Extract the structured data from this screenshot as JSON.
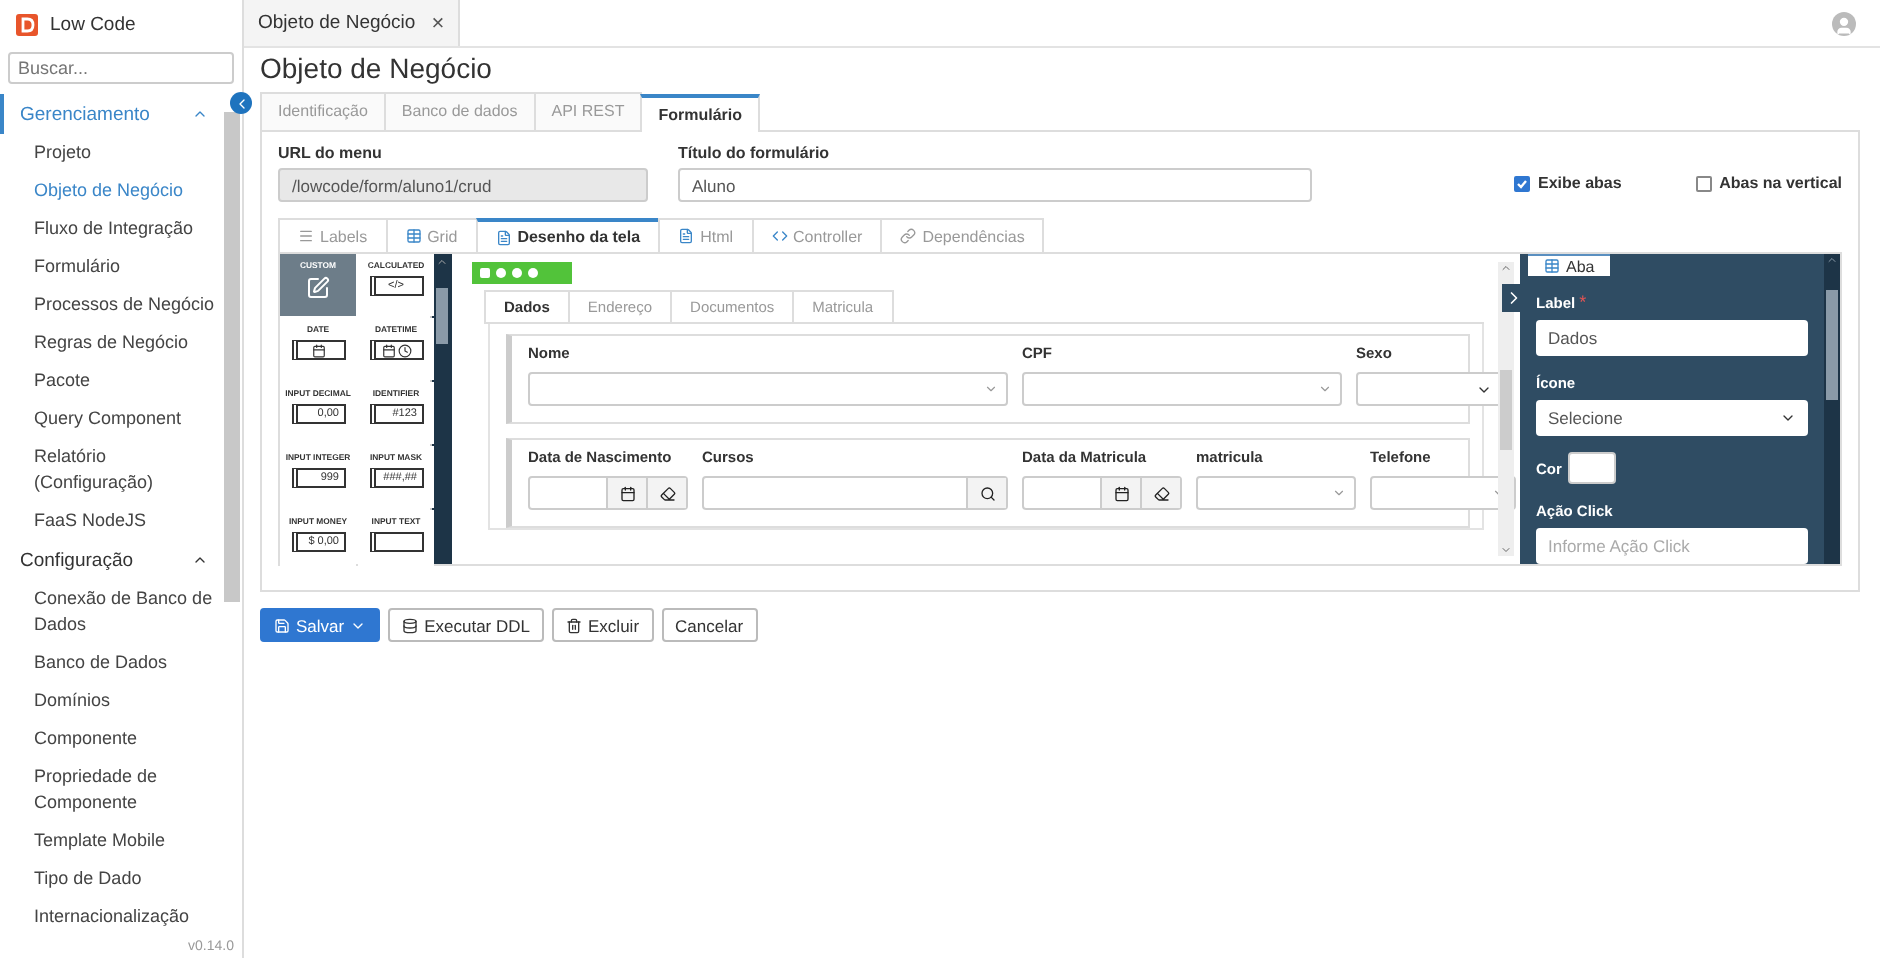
{
  "app": {
    "name": "Low Code",
    "version": "v0.14.0"
  },
  "sidebar": {
    "search": {
      "placeholder": "Buscar..."
    },
    "groups": [
      {
        "label": "Gerenciamento",
        "selected": true,
        "expanded": true,
        "items": [
          {
            "label": "Projeto",
            "selected": false
          },
          {
            "label": "Objeto de Negócio",
            "selected": true
          },
          {
            "label": "Fluxo de Integração",
            "selected": false
          },
          {
            "label": "Formulário",
            "selected": false
          },
          {
            "label": "Processos de Negócio",
            "selected": false
          },
          {
            "label": "Regras de Negócio",
            "selected": false
          },
          {
            "label": "Pacote",
            "selected": false
          },
          {
            "label": "Query Component",
            "selected": false
          },
          {
            "label": "Relatório (Configuração)",
            "selected": false
          },
          {
            "label": "FaaS NodeJS",
            "selected": false
          }
        ]
      },
      {
        "label": "Configuração",
        "selected": false,
        "expanded": true,
        "items": [
          {
            "label": "Conexão de Banco de Dados",
            "selected": false
          },
          {
            "label": "Banco de Dados",
            "selected": false
          },
          {
            "label": "Domínios",
            "selected": false
          },
          {
            "label": "Componente",
            "selected": false
          },
          {
            "label": "Propriedade de Componente",
            "selected": false
          },
          {
            "label": "Template Mobile",
            "selected": false
          },
          {
            "label": "Tipo de Dado",
            "selected": false
          },
          {
            "label": "Internacionalização",
            "selected": false
          }
        ]
      }
    ]
  },
  "doc_tabs": [
    {
      "label": "Objeto de Negócio",
      "close": "×"
    }
  ],
  "page_title": "Objeto de Negócio",
  "tabs": [
    {
      "label": "Identificação",
      "selected": false
    },
    {
      "label": "Banco de dados",
      "selected": false
    },
    {
      "label": "API REST",
      "selected": false
    },
    {
      "label": "Formulário",
      "selected": true
    }
  ],
  "form": {
    "url": {
      "label": "URL do menu",
      "value": "/lowcode/form/aluno1/crud",
      "disabled": true
    },
    "title": {
      "label": "Título do formulário",
      "value": "Aluno"
    },
    "checkboxes": [
      {
        "label": "Exibe abas",
        "checked": true
      },
      {
        "label": "Abas na vertical",
        "checked": false
      }
    ]
  },
  "inner_tabs": [
    {
      "label": "Labels",
      "selected": false
    },
    {
      "label": "Grid",
      "selected": false
    },
    {
      "label": "Desenho da tela",
      "selected": true
    },
    {
      "label": "Html",
      "selected": false
    },
    {
      "label": "Controller",
      "selected": false
    },
    {
      "label": "Dependências",
      "selected": false
    }
  ],
  "palette": [
    {
      "label": "CUSTOM",
      "kind": "edit",
      "selected": true
    },
    {
      "label": "CALCULATED",
      "kind": "code",
      "preview": "</>",
      "selected": false
    },
    {
      "label": "DATE",
      "kind": "date",
      "selected": false
    },
    {
      "label": "DATETIME",
      "kind": "datetime",
      "selected": false
    },
    {
      "label": "INPUT DECIMAL",
      "kind": "input",
      "preview": "0,00",
      "selected": false
    },
    {
      "label": "IDENTIFIER",
      "kind": "input",
      "preview": "#123",
      "selected": false
    },
    {
      "label": "INPUT INTEGER",
      "kind": "input",
      "preview": "999",
      "selected": false
    },
    {
      "label": "INPUT MASK",
      "kind": "input",
      "preview": "###,##",
      "selected": false
    },
    {
      "label": "INPUT MONEY",
      "kind": "input",
      "preview": "$ 0,00",
      "selected": false
    },
    {
      "label": "INPUT TEXT",
      "kind": "input",
      "selected": false
    }
  ],
  "form_tabs": [
    {
      "label": "Dados",
      "selected": true
    },
    {
      "label": "Endereço",
      "selected": false
    },
    {
      "label": "Documentos",
      "selected": false
    },
    {
      "label": "Matricula",
      "selected": false
    }
  ],
  "form_rows": [
    [
      {
        "label": "Nome",
        "kind": "number"
      },
      {
        "label": "CPF",
        "kind": "number"
      },
      {
        "label": "Sexo",
        "kind": "select"
      }
    ],
    [
      {
        "label": "Data de Nascimento",
        "kind": "date"
      },
      {
        "label": "Cursos",
        "kind": "search"
      },
      {
        "label": "Data da Matricula",
        "kind": "date"
      },
      {
        "label": "matricula",
        "kind": "number"
      },
      {
        "label": "Telefone",
        "kind": "number"
      }
    ]
  ],
  "properties": {
    "tab": "Aba",
    "fields": [
      {
        "label": "Label",
        "required_mark": "*",
        "kind": "text",
        "value": "Dados"
      },
      {
        "label": "Ícone",
        "kind": "select",
        "value": "Selecione"
      },
      {
        "label": "Cor",
        "kind": "color"
      },
      {
        "label": "Ação Click",
        "kind": "text",
        "placeholder": "Informe Ação Click"
      }
    ]
  },
  "buttons": [
    {
      "label": "Salvar",
      "kind": "primary"
    },
    {
      "label": "Executar DDL",
      "kind": "database"
    },
    {
      "label": "Excluir",
      "kind": "trash"
    },
    {
      "label": "Cancelar",
      "kind": "plain"
    }
  ]
}
